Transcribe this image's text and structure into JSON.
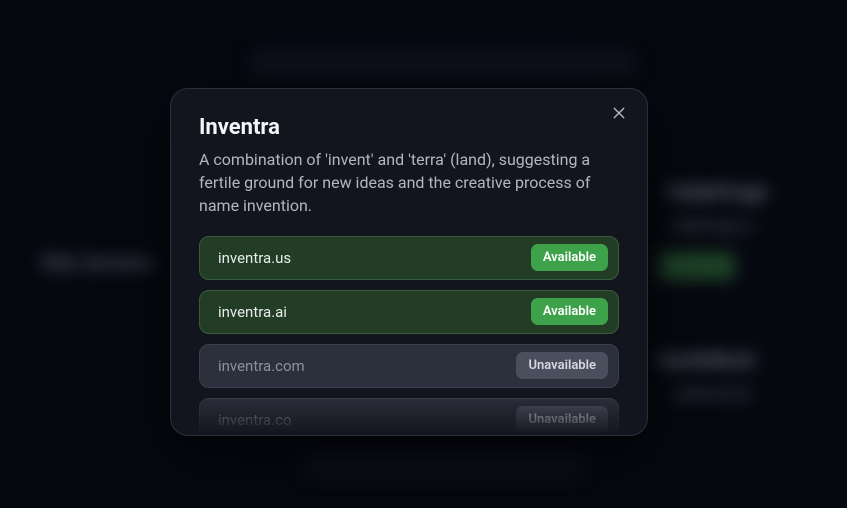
{
  "modal": {
    "title": "Inventra",
    "description": "A combination of 'invent' and 'terra' (land), suggesting a fertile ground for new ideas and the creative process of name invention.",
    "close_aria": "Close",
    "domains": [
      {
        "name": "inventra.us",
        "status": "available",
        "label": "Available"
      },
      {
        "name": "inventra.ai",
        "status": "available",
        "label": "Available"
      },
      {
        "name": "inventra.com",
        "status": "unavailable",
        "label": "Unavailable"
      },
      {
        "name": "inventra.co",
        "status": "unavailable",
        "label": "Unavailable"
      }
    ]
  },
  "background": {
    "sidebar_label": "filter domains",
    "card1": {
      "title": "FableForge",
      "sub": "fableforge.ai"
    },
    "card2": {
      "title": "QuirkWord",
      "sub": "quirkword.io"
    }
  },
  "colors": {
    "available_bg": "#233c25",
    "available_badge": "#3ea24a",
    "unavailable_bg": "#2c2f3c",
    "unavailable_badge": "#4b4e5d"
  }
}
